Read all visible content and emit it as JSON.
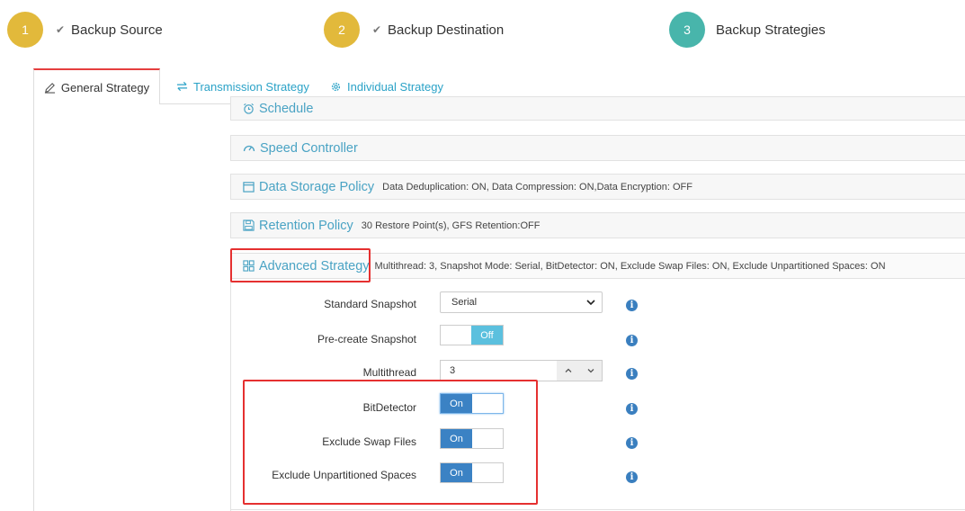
{
  "wizard": {
    "steps": [
      {
        "number": "1",
        "label": "Backup Source",
        "check": "✔",
        "color": "#e2b93b"
      },
      {
        "number": "2",
        "label": "Backup Destination",
        "check": "✔",
        "color": "#e2b93b"
      },
      {
        "number": "3",
        "label": "Backup Strategies",
        "check": "",
        "color": "#48b5ab"
      }
    ]
  },
  "tabs": [
    {
      "label": "General Strategy",
      "active": true
    },
    {
      "label": "Transmission Strategy",
      "active": false
    },
    {
      "label": "Individual Strategy",
      "active": false
    }
  ],
  "panels": {
    "schedule": {
      "title": "Schedule"
    },
    "speed": {
      "title": "Speed Controller"
    },
    "storage": {
      "title": "Data Storage Policy",
      "summary": "Data Deduplication: ON, Data Compression: ON,Data Encryption: OFF"
    },
    "retention": {
      "title": "Retention Policy",
      "summary": "30 Restore Point(s), GFS Retention:OFF"
    },
    "advanced": {
      "title": "Advanced Strategy",
      "summary": "Multithread: 3, Snapshot Mode: Serial, BitDetector: ON, Exclude Swap Files: ON, Exclude Unpartitioned Spaces: ON"
    }
  },
  "form": {
    "standard_snapshot": {
      "label": "Standard Snapshot",
      "value": "Serial"
    },
    "precreate_snapshot": {
      "label": "Pre-create Snapshot",
      "state": "Off"
    },
    "multithread": {
      "label": "Multithread",
      "value": "3"
    },
    "bitdetector": {
      "label": "BitDetector",
      "state": "On"
    },
    "exclude_swap": {
      "label": "Exclude Swap Files",
      "state": "On"
    },
    "exclude_unpartitioned": {
      "label": "Exclude Unpartitioned Spaces",
      "state": "On"
    }
  },
  "info_glyph": "i",
  "colors": {
    "accent": "#4aa3c4",
    "toggle_on": "#3b82c4",
    "toggle_off": "#5bc0de",
    "highlight": "#e53030",
    "active_tab": "#e53e3e"
  }
}
